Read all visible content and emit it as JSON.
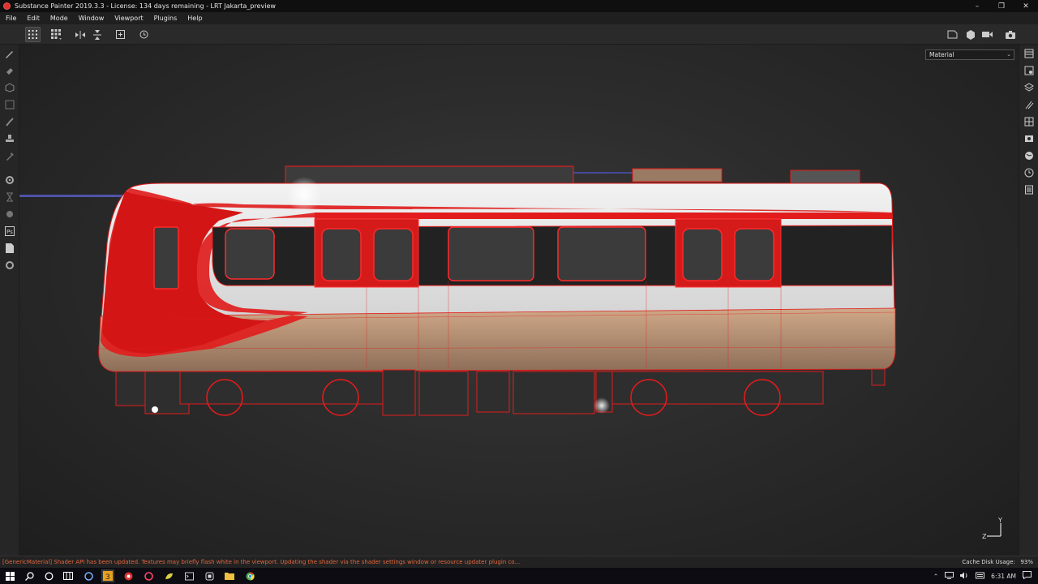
{
  "window": {
    "title": "Substance Painter 2019.3.3 - License: 134 days remaining - LRT Jakarta_preview",
    "controls": [
      "–",
      "❐",
      "✕"
    ]
  },
  "menu": [
    "File",
    "Edit",
    "Mode",
    "Window",
    "Viewport",
    "Plugins",
    "Help"
  ],
  "viewport": {
    "display_mode": "Material",
    "gizmo": {
      "y": "Y",
      "z": "Z"
    }
  },
  "status": {
    "message": "[GenericMaterial] Shader API has been updated. Textures may briefly flash white in the viewport. Updating the shader via the shader settings window or resource updater plugin co...",
    "cache_label": "Cache Disk Usage:",
    "cache_value": "93%"
  },
  "taskbar": {
    "time": "6:31 AM"
  },
  "colors": {
    "accent_red": "#e21c1c",
    "status_orange": "#e4663c"
  }
}
